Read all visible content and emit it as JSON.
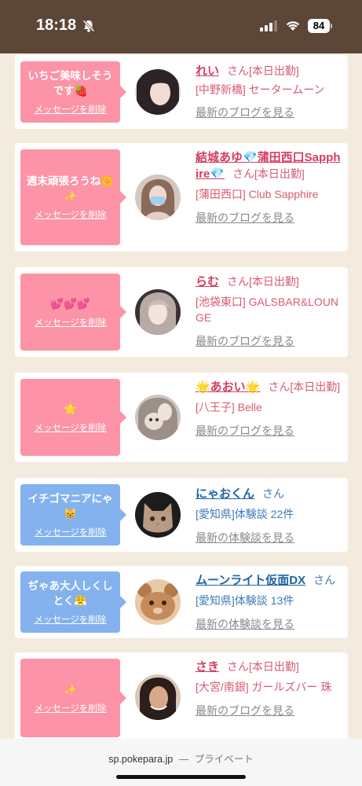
{
  "status_bar": {
    "time": "18:18",
    "battery": "84"
  },
  "bubbles": [
    {
      "text": "いちご美味しそうです🍓",
      "delete": "メッセージを削除"
    },
    {
      "text": "週末頑張ろうね🌼✨",
      "delete": "メッセージを削除"
    },
    {
      "text": "💕💕💕",
      "delete": "メッセージを削除"
    },
    {
      "text": "🌟",
      "delete": "メッセージを削除"
    },
    {
      "text": "イチゴマニアにゃ😸",
      "delete": "メッセージを削除"
    },
    {
      "text": "ぢゃあ大人しくしとく😤",
      "delete": "メッセージを削除"
    },
    {
      "text": "✨",
      "delete": "メッセージを削除"
    }
  ],
  "entries": [
    {
      "name": "れい",
      "suffix": "さん[本日出勤]",
      "shop": "[中野新橋] セータームーン",
      "link": "最新のブログを見る"
    },
    {
      "name": "結城あゆ💎蒲田西口Sapphire💎",
      "suffix": "さん[本日出勤]",
      "shop": "[蒲田西口] Club Sapphire",
      "link": "最新のブログを見る"
    },
    {
      "name": "らむ",
      "suffix": "さん[本日出勤]",
      "shop": "[池袋東口] GALSBAR&LOUNGE",
      "link": "最新のブログを見る"
    },
    {
      "name": "🌟あおい🌟",
      "suffix": "さん[本日出勤]",
      "shop": "[八王子] Belle",
      "link": "最新のブログを見る"
    },
    {
      "name": "にゃおくん",
      "suffix": "さん",
      "shop": "[愛知県]体験談 22件",
      "link": "最新の体験談を見る"
    },
    {
      "name": "ムーンライト仮面DX",
      "suffix": "さん",
      "shop": "[愛知県]体験談 13件",
      "link": "最新の体験談を見る"
    },
    {
      "name": "さき",
      "suffix": "さん[本日出勤]",
      "shop": "[大宮/南銀] ガールズバー 珠",
      "link": "最新のブログを見る"
    }
  ],
  "browser": {
    "url": "sp.pokepara.jp",
    "separator": "—",
    "mode": "プライベート"
  },
  "colors": {
    "pink_bubble": "#fc93a6",
    "blue_bubble": "#83b2ee",
    "cast_name": "#d53c63",
    "user_name": "#1f64a6",
    "status_bar": "#5b4637",
    "page_bg": "#f4ebdf"
  },
  "icons": [
    "bell-slash-icon",
    "signal-icon",
    "wifi-icon",
    "battery-icon"
  ]
}
